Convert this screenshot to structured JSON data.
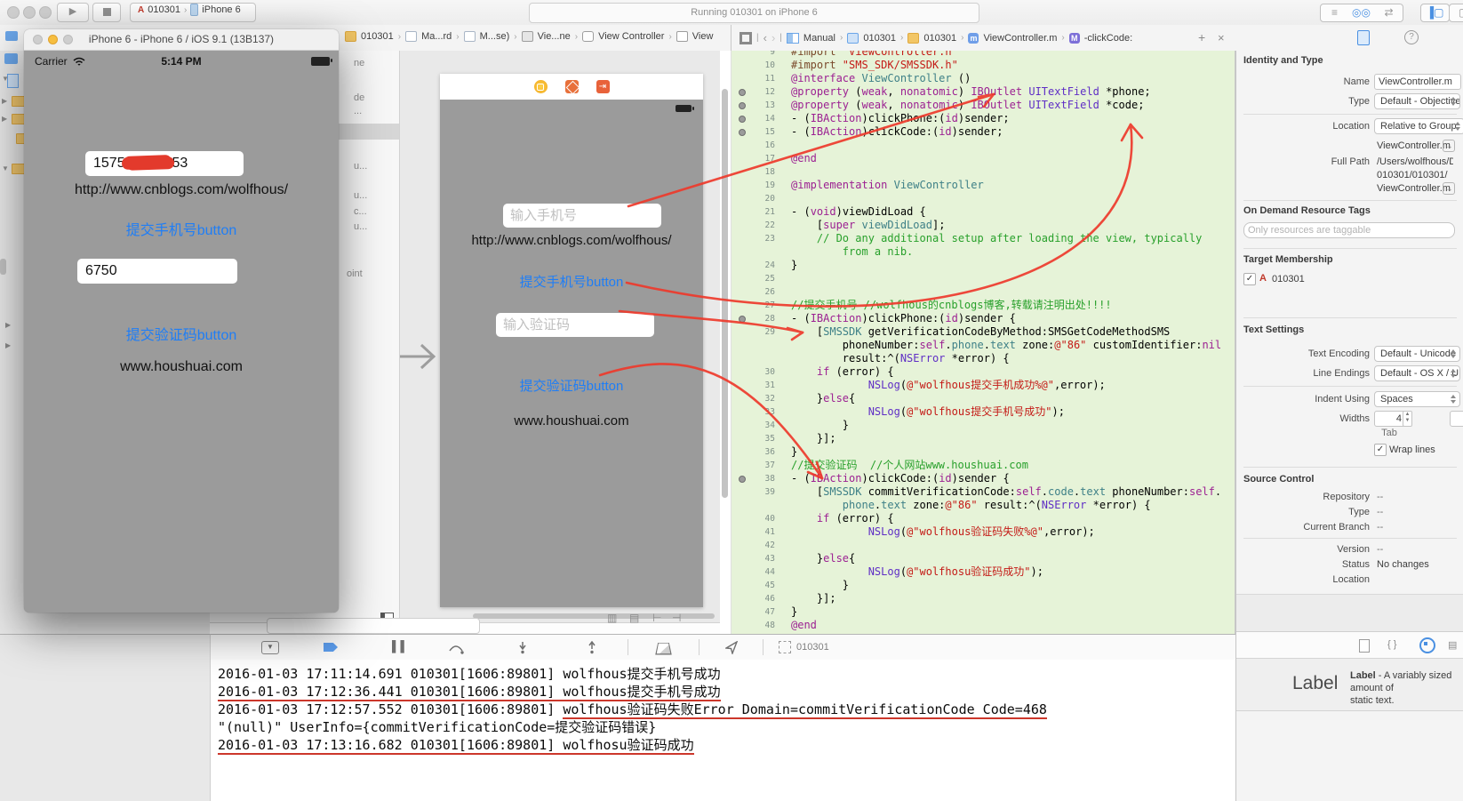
{
  "toolbar": {
    "scheme_target": "010301",
    "scheme_device": "iPhone 6",
    "status": "Running 010301 on iPhone 6"
  },
  "jumpbar": {
    "left": [
      "010301",
      "Ma...rd",
      "M...se)",
      "Vie...ne",
      "View Controller",
      "View"
    ],
    "assistant": [
      "Manual",
      "010301",
      "010301",
      "ViewController.m",
      "-clickCode:"
    ],
    "add": "+",
    "close": "×"
  },
  "simulator": {
    "title": "iPhone 6 - iPhone 6 / iOS 9.1 (13B137)",
    "carrier": "Carrier",
    "time": "5:14 PM",
    "phone_prefix": "1575",
    "phone_suffix": "953",
    "url": "http://www.cnblogs.com/wolfhous/",
    "submit_phone": "提交手机号button",
    "code": "6750",
    "submit_code": "提交验证码button",
    "site": "www.houshuai.com"
  },
  "storyboard": {
    "outline": [
      "ne",
      "de",
      "...",
      "u...",
      "u...",
      "c...",
      "u...",
      "oint"
    ],
    "phone_placeholder": "输入手机号",
    "url": "http://www.cnblogs.com/wolfhous/",
    "submit_phone": "提交手机号button",
    "code_placeholder": "输入验证码",
    "submit_code": "提交验证码button",
    "site": "www.houshuai.com"
  },
  "editor": {
    "lines": [
      {
        "n": "9",
        "dot": false,
        "rows": [
          [
            [
              "d",
              "#import "
            ],
            [
              "s",
              "\"ViewController.h\""
            ]
          ]
        ]
      },
      {
        "n": "10",
        "dot": false,
        "rows": [
          [
            [
              "d",
              "#import "
            ],
            [
              "s",
              "\"SMS_SDK/SMSSDK.h\""
            ]
          ]
        ]
      },
      {
        "n": "11",
        "dot": false,
        "rows": [
          [
            [
              "k",
              "@interface"
            ],
            [
              "p",
              " "
            ],
            [
              "n",
              "ViewController"
            ],
            [
              "p",
              " ()"
            ]
          ]
        ]
      },
      {
        "n": "12",
        "dot": true,
        "rows": [
          [
            [
              "k",
              "@property"
            ],
            [
              "p",
              " ("
            ],
            [
              "k",
              "weak"
            ],
            [
              "p",
              ", "
            ],
            [
              "k",
              "nonatomic"
            ],
            [
              "p",
              ") "
            ],
            [
              "k",
              "IBOutlet"
            ],
            [
              "p",
              " "
            ],
            [
              "t",
              "UITextField"
            ],
            [
              "p",
              " *phone;"
            ]
          ]
        ]
      },
      {
        "n": "13",
        "dot": true,
        "rows": [
          [
            [
              "k",
              "@property"
            ],
            [
              "p",
              " ("
            ],
            [
              "k",
              "weak"
            ],
            [
              "p",
              ", "
            ],
            [
              "k",
              "nonatomic"
            ],
            [
              "p",
              ") "
            ],
            [
              "k",
              "IBOutlet"
            ],
            [
              "p",
              " "
            ],
            [
              "t",
              "UITextField"
            ],
            [
              "p",
              " *code;"
            ]
          ]
        ]
      },
      {
        "n": "14",
        "dot": true,
        "rows": [
          [
            [
              "p",
              "- ("
            ],
            [
              "k",
              "IBAction"
            ],
            [
              "p",
              ")clickPhone:("
            ],
            [
              "k",
              "id"
            ],
            [
              "p",
              ")sender;"
            ]
          ]
        ]
      },
      {
        "n": "15",
        "dot": true,
        "rows": [
          [
            [
              "p",
              "- ("
            ],
            [
              "k",
              "IBAction"
            ],
            [
              "p",
              ")clickCode:("
            ],
            [
              "k",
              "id"
            ],
            [
              "p",
              ")sender;"
            ]
          ]
        ]
      },
      {
        "n": "16",
        "dot": false,
        "rows": [
          []
        ]
      },
      {
        "n": "17",
        "dot": false,
        "rows": [
          [
            [
              "k",
              "@end"
            ]
          ]
        ]
      },
      {
        "n": "18",
        "dot": false,
        "rows": [
          []
        ]
      },
      {
        "n": "19",
        "dot": false,
        "rows": [
          [
            [
              "k",
              "@implementation"
            ],
            [
              "p",
              " "
            ],
            [
              "n",
              "ViewController"
            ]
          ]
        ]
      },
      {
        "n": "20",
        "dot": false,
        "rows": [
          []
        ]
      },
      {
        "n": "21",
        "dot": false,
        "rows": [
          [
            [
              "p",
              "- ("
            ],
            [
              "k",
              "void"
            ],
            [
              "p",
              ")viewDidLoad {"
            ]
          ]
        ]
      },
      {
        "n": "22",
        "dot": false,
        "rows": [
          [
            [
              "p",
              "    ["
            ],
            [
              "k",
              "super"
            ],
            [
              "p",
              " "
            ],
            [
              "n",
              "viewDidLoad"
            ],
            [
              "p",
              "];"
            ]
          ]
        ]
      },
      {
        "n": "23",
        "dot": false,
        "rows": [
          [
            [
              "c",
              "    // Do any additional setup after loading the view, typically"
            ]
          ],
          [
            [
              "c",
              "        from a nib."
            ]
          ]
        ]
      },
      {
        "n": "24",
        "dot": false,
        "rows": [
          [
            [
              "p",
              "}"
            ]
          ]
        ]
      },
      {
        "n": "25",
        "dot": false,
        "rows": [
          []
        ]
      },
      {
        "n": "26",
        "dot": false,
        "rows": [
          []
        ]
      },
      {
        "n": "27",
        "dot": false,
        "rows": [
          [
            [
              "c",
              "//提交手机号 //wolfhous的cnblogs博客,转载请注明出处!!!!"
            ]
          ]
        ]
      },
      {
        "n": "28",
        "dot": true,
        "rows": [
          [
            [
              "p",
              "- ("
            ],
            [
              "k",
              "IBAction"
            ],
            [
              "p",
              ")clickPhone:("
            ],
            [
              "k",
              "id"
            ],
            [
              "p",
              ")sender {"
            ]
          ]
        ]
      },
      {
        "n": "29",
        "dot": false,
        "rows": [
          [
            [
              "p",
              "    ["
            ],
            [
              "n",
              "SMSSDK"
            ],
            [
              "p",
              " getVerificationCodeByMethod:SMSGetCodeMethodSMS"
            ]
          ],
          [
            [
              "p",
              "        phoneNumber:"
            ],
            [
              "k",
              "self"
            ],
            [
              "p",
              "."
            ],
            [
              "n",
              "phone"
            ],
            [
              "p",
              "."
            ],
            [
              "n",
              "text"
            ],
            [
              "p",
              " zone:"
            ],
            [
              "s",
              "@\"86\""
            ],
            [
              "p",
              " customIdentifier:"
            ],
            [
              "k",
              "nil"
            ]
          ],
          [
            [
              "p",
              "        result:^("
            ],
            [
              "t",
              "NSError"
            ],
            [
              "p",
              " *error) {"
            ]
          ]
        ]
      },
      {
        "n": "30",
        "dot": false,
        "rows": [
          [
            [
              "p",
              "    "
            ],
            [
              "k",
              "if"
            ],
            [
              "p",
              " (error) {"
            ]
          ]
        ]
      },
      {
        "n": "31",
        "dot": false,
        "rows": [
          [
            [
              "p",
              "            "
            ],
            [
              "t",
              "NSLog"
            ],
            [
              "p",
              "("
            ],
            [
              "s",
              "@\"wolfhous提交手机成功%@\""
            ],
            [
              "p",
              ",error);"
            ]
          ]
        ]
      },
      {
        "n": "32",
        "dot": false,
        "rows": [
          [
            [
              "p",
              "    }"
            ],
            [
              "k",
              "else"
            ],
            [
              "p",
              "{"
            ]
          ]
        ]
      },
      {
        "n": "33",
        "dot": false,
        "rows": [
          [
            [
              "p",
              "            "
            ],
            [
              "t",
              "NSLog"
            ],
            [
              "p",
              "("
            ],
            [
              "s",
              "@\"wolfhous提交手机号成功\""
            ],
            [
              "p",
              ");"
            ]
          ]
        ]
      },
      {
        "n": "34",
        "dot": false,
        "rows": [
          [
            [
              "p",
              "        }"
            ]
          ]
        ]
      },
      {
        "n": "35",
        "dot": false,
        "rows": [
          [
            [
              "p",
              "    }];"
            ]
          ]
        ]
      },
      {
        "n": "36",
        "dot": false,
        "rows": [
          [
            [
              "p",
              "}"
            ]
          ]
        ]
      },
      {
        "n": "37",
        "dot": false,
        "rows": [
          [
            [
              "c",
              "//提交验证码  //个人网站www.houshuai.com"
            ]
          ]
        ]
      },
      {
        "n": "38",
        "dot": true,
        "rows": [
          [
            [
              "p",
              "- ("
            ],
            [
              "k",
              "IBAction"
            ],
            [
              "p",
              ")clickCode:("
            ],
            [
              "k",
              "id"
            ],
            [
              "p",
              ")sender {"
            ]
          ]
        ]
      },
      {
        "n": "39",
        "dot": false,
        "rows": [
          [
            [
              "p",
              "    ["
            ],
            [
              "n",
              "SMSSDK"
            ],
            [
              "p",
              " commitVerificationCode:"
            ],
            [
              "k",
              "self"
            ],
            [
              "p",
              "."
            ],
            [
              "n",
              "code"
            ],
            [
              "p",
              "."
            ],
            [
              "n",
              "text"
            ],
            [
              "p",
              " phoneNumber:"
            ],
            [
              "k",
              "self"
            ],
            [
              "p",
              "."
            ]
          ],
          [
            [
              "p",
              "        "
            ],
            [
              "n",
              "phone"
            ],
            [
              "p",
              "."
            ],
            [
              "n",
              "text"
            ],
            [
              "p",
              " zone:"
            ],
            [
              "s",
              "@\"86\""
            ],
            [
              "p",
              " result:^("
            ],
            [
              "t",
              "NSError"
            ],
            [
              "p",
              " *error) {"
            ]
          ]
        ]
      },
      {
        "n": "40",
        "dot": false,
        "rows": [
          [
            [
              "p",
              "    "
            ],
            [
              "k",
              "if"
            ],
            [
              "p",
              " (error) {"
            ]
          ]
        ]
      },
      {
        "n": "41",
        "dot": false,
        "rows": [
          [
            [
              "p",
              "            "
            ],
            [
              "t",
              "NSLog"
            ],
            [
              "p",
              "("
            ],
            [
              "s",
              "@\"wolfhous验证码失败%@\""
            ],
            [
              "p",
              ",error);"
            ]
          ]
        ]
      },
      {
        "n": "42",
        "dot": false,
        "rows": [
          []
        ]
      },
      {
        "n": "43",
        "dot": false,
        "rows": [
          [
            [
              "p",
              "    }"
            ],
            [
              "k",
              "else"
            ],
            [
              "p",
              "{"
            ]
          ]
        ]
      },
      {
        "n": "44",
        "dot": false,
        "rows": [
          [
            [
              "p",
              "            "
            ],
            [
              "t",
              "NSLog"
            ],
            [
              "p",
              "("
            ],
            [
              "s",
              "@\"wolfhosu验证码成功\""
            ],
            [
              "p",
              ");"
            ]
          ]
        ]
      },
      {
        "n": "45",
        "dot": false,
        "rows": [
          [
            [
              "p",
              "        }"
            ]
          ]
        ]
      },
      {
        "n": "46",
        "dot": false,
        "rows": [
          [
            [
              "p",
              "    }];"
            ]
          ]
        ]
      },
      {
        "n": "47",
        "dot": false,
        "rows": [
          [
            [
              "p",
              "}"
            ]
          ]
        ]
      },
      {
        "n": "48",
        "dot": false,
        "rows": [
          [
            [
              "k",
              "@end"
            ]
          ]
        ]
      }
    ]
  },
  "inspector": {
    "identity": {
      "header": "Identity and Type",
      "name_label": "Name",
      "name": "ViewController.m",
      "type_label": "Type",
      "type": "Default - Objective",
      "location_label": "Location",
      "location": "Relative to Group",
      "filename": "ViewController.m",
      "fullpath_label": "Full Path",
      "fullpath1": "/Users/wolfhous/De",
      "fullpath2": "010301/010301/",
      "fullpath3": "ViewController.m"
    },
    "odr": {
      "header": "On Demand Resource Tags",
      "placeholder": "Only resources are taggable"
    },
    "target": {
      "header": "Target Membership",
      "item": "010301"
    },
    "textset": {
      "header": "Text Settings",
      "encoding_label": "Text Encoding",
      "encoding": "Default - Unicode",
      "endings_label": "Line Endings",
      "endings": "Default - OS X / U",
      "indent_label": "Indent Using",
      "indent": "Spaces",
      "widths_label": "Widths",
      "width_value": "4",
      "tab": "Tab",
      "wrap": "Wrap lines"
    },
    "scm": {
      "header": "Source Control",
      "repo_label": "Repository",
      "repo": "--",
      "type_label": "Type",
      "type": "--",
      "branch_label": "Current Branch",
      "branch": "--",
      "version_label": "Version",
      "version": "--",
      "status_label": "Status",
      "status": "No changes",
      "location_label": "Location"
    }
  },
  "library": {
    "image": "Label",
    "name": "Label",
    "desc": " - A variably sized amount of",
    "desc2": "static text."
  },
  "debug": {
    "app": "010301",
    "console": [
      [
        {
          "t": "2016-01-03 17:11:14.691 010301[1606:89801] wolfhous提交手机号成功",
          "u": false
        }
      ],
      [
        {
          "t": "2016-01-03 17:12:36.441 010301[1606:89801] wolfhous提交手机号成功",
          "u": true
        }
      ],
      [
        {
          "t": "2016-01-03 17:12:57.552 010301[1606:89801] ",
          "u": false
        },
        {
          "t": "wolfhous验证码失败Error Domain=commitVerificationCode Code=468",
          "u": true
        }
      ],
      [
        {
          "t": "\"(null)\" UserInfo={commitVerificationCode=提交验证码错误}",
          "u": false
        }
      ],
      [
        {
          "t": "2016-01-03 17:13:16.682 010301[1606:89801] wolfhosu验证码成功",
          "u": true
        }
      ]
    ]
  }
}
